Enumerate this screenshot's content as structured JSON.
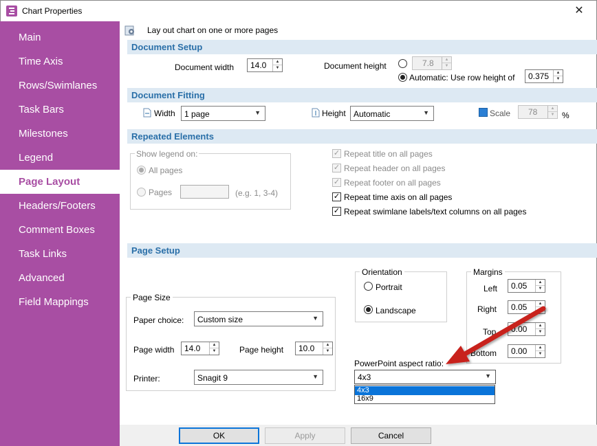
{
  "window": {
    "title": "Chart Properties",
    "close_glyph": "✕"
  },
  "sidebar": {
    "items": [
      {
        "label": "Main"
      },
      {
        "label": "Time Axis"
      },
      {
        "label": "Rows/Swimlanes"
      },
      {
        "label": "Task Bars"
      },
      {
        "label": "Milestones"
      },
      {
        "label": "Legend"
      },
      {
        "label": "Page Layout"
      },
      {
        "label": "Headers/Footers"
      },
      {
        "label": "Comment Boxes"
      },
      {
        "label": "Task Links"
      },
      {
        "label": "Advanced"
      },
      {
        "label": "Field Mappings"
      }
    ],
    "active": "Page Layout",
    "accent_color": "#a84ea3"
  },
  "intro": {
    "text": "Lay out chart on one or more pages",
    "icon": "gear-icon"
  },
  "document_setup": {
    "header": "Document Setup",
    "width_label": "Document width",
    "width_value": "14.0",
    "height_label": "Document height",
    "height_value": "7.8",
    "auto_label": "Automatic: Use row height of",
    "row_height_value": "0.375"
  },
  "document_fitting": {
    "header": "Document Fitting",
    "width_label": "Width",
    "width_value": "1 page",
    "height_label": "Height",
    "height_value": "Automatic",
    "scale_label": "Scale",
    "scale_value": "78",
    "scale_unit": "%"
  },
  "repeated_elements": {
    "header": "Repeated Elements",
    "legend_group_label": "Show legend on:",
    "all_pages_label": "All pages",
    "pages_label": "Pages",
    "pages_hint": "(e.g. 1, 3-4)",
    "checks": [
      {
        "label": "Repeat title on all pages",
        "checked": true,
        "enabled": false
      },
      {
        "label": "Repeat header on all pages",
        "checked": true,
        "enabled": false
      },
      {
        "label": "Repeat footer on all pages",
        "checked": true,
        "enabled": false
      },
      {
        "label": "Repeat time axis on all pages",
        "checked": true,
        "enabled": true
      },
      {
        "label": "Repeat swimlane labels/text columns on all pages",
        "checked": true,
        "enabled": true
      }
    ]
  },
  "page_setup": {
    "header": "Page Setup",
    "orientation_label": "Orientation",
    "portrait_label": "Portrait",
    "landscape_label": "Landscape",
    "margins_label": "Margins",
    "left_label": "Left",
    "left_value": "0.05",
    "right_label": "Right",
    "right_value": "0.05",
    "top_label": "Top",
    "top_value": "0.00",
    "bottom_label": "Bottom",
    "bottom_value": "0.00",
    "page_size_label": "Page Size",
    "paper_choice_label": "Paper choice:",
    "paper_choice_value": "Custom size",
    "page_width_label": "Page width",
    "page_width_value": "14.0",
    "page_height_label": "Page height",
    "page_height_value": "10.0",
    "printer_label": "Printer:",
    "printer_value": "Snagit 9",
    "ppt_label": "PowerPoint aspect ratio:",
    "ppt_value": "4x3",
    "ppt_options": [
      "4x3",
      "16x9"
    ]
  },
  "buttons": {
    "ok": "OK",
    "apply": "Apply",
    "cancel": "Cancel"
  },
  "colors": {
    "section_header_bg": "#dde9f3",
    "section_header_text": "#2a6fa8",
    "annotation_arrow": "#c8201e",
    "selection": "#0a74d9"
  }
}
